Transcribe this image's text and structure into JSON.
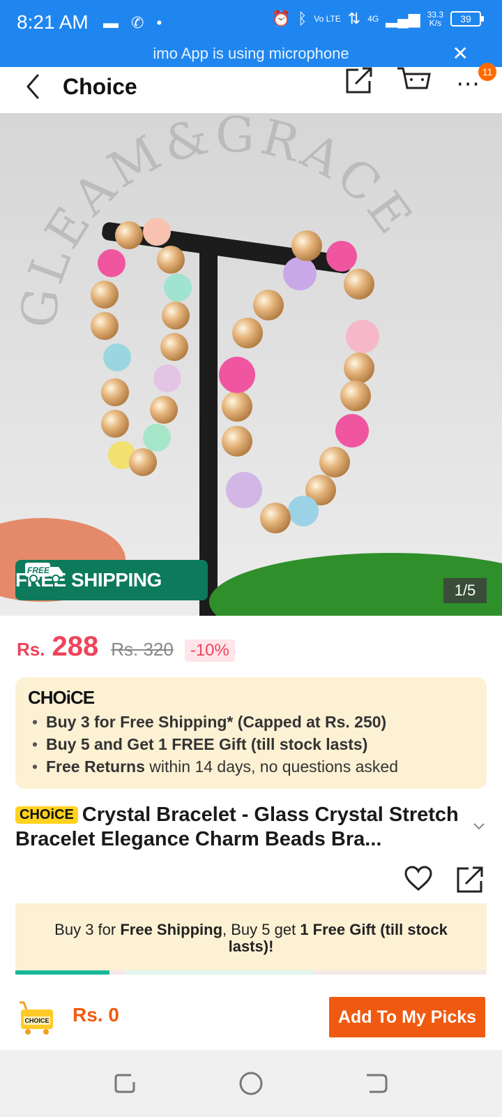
{
  "status_bar": {
    "time": "8:21 AM",
    "network_speed_value": "33.3",
    "network_speed_unit": "K/s",
    "volte": "Vo LTE",
    "network_type": "4G",
    "battery": "39",
    "mic_banner": "imo App is using microphone"
  },
  "appbar": {
    "title": "Choice",
    "cart_badge": "11"
  },
  "gallery": {
    "free_shipping_label": "FREE SHIPPING",
    "free_mark": "FREE",
    "counter": "1/5",
    "watermark": "GLEAM&GRACE"
  },
  "price": {
    "currency": "Rs.",
    "value": "288",
    "original": "Rs. 320",
    "discount": "-10%"
  },
  "choice_card": {
    "logo": "CHOiCE",
    "benefits": [
      {
        "bold": "Buy 3 for  Free Shipping* (Capped at Rs. 250)",
        "rest": ""
      },
      {
        "bold": "Buy 5 and Get 1 FREE Gift (till stock lasts)",
        "rest": ""
      },
      {
        "bold": "Free Returns",
        "rest": " within 14 days, no questions asked"
      }
    ]
  },
  "product": {
    "badge": "CHOiCE",
    "title": "Crystal Bracelet - Glass Crystal Stretch Bracelet Elegance Charm Beads Bra..."
  },
  "promo": {
    "p1": "Buy 3 for ",
    "b1": "Free Shipping",
    "p2": ", Buy 5 get ",
    "b2": "1 Free Gift (till stock lasts)!",
    "progress": 0.2
  },
  "action_bar": {
    "picks_icon_label": "CHOICE",
    "total": "Rs. 0",
    "add_button": "Add To My Picks"
  },
  "colors": {
    "status_blue": "#1f86f0",
    "price_red": "#f0435a",
    "choice_bg": "#fdf1d4",
    "free_ship_green": "#0c7a5b",
    "action_orange": "#f05a10",
    "progress_teal": "#17b89a"
  }
}
